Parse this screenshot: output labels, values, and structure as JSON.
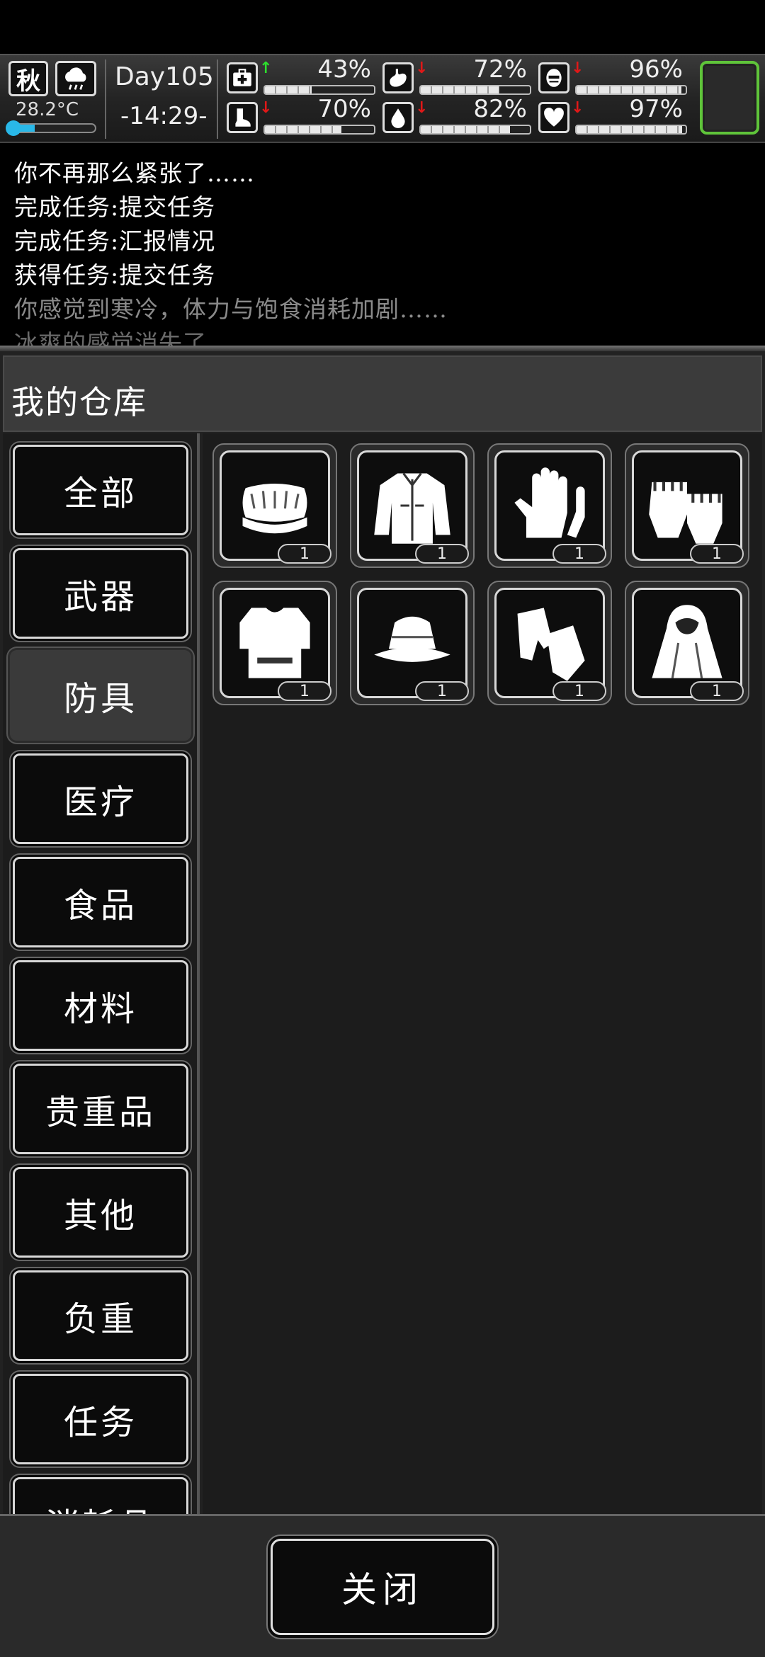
{
  "status": {
    "season": "秋",
    "weather_icon": "cloud-rain-icon",
    "temperature": "28.2°C",
    "temperature_level": 0.3,
    "day": "Day105",
    "time": "-14:29-",
    "stats": [
      {
        "icon": "medkit-icon",
        "trend": "up",
        "arrow": "↑",
        "value": "43%",
        "level": 0.43
      },
      {
        "icon": "stomach-icon",
        "trend": "down",
        "arrow": "↓",
        "value": "72%",
        "level": 0.72
      },
      {
        "icon": "face-mask-icon",
        "trend": "down",
        "arrow": "↓",
        "value": "96%",
        "level": 0.96
      },
      {
        "icon": "boot-icon",
        "trend": "down",
        "arrow": "↓",
        "value": "70%",
        "level": 0.7
      },
      {
        "icon": "water-drop-icon",
        "trend": "down",
        "arrow": "↓",
        "value": "82%",
        "level": 0.82
      },
      {
        "icon": "heart-icon",
        "trend": "down",
        "arrow": "↓",
        "value": "97%",
        "level": 0.97
      }
    ],
    "accent_color": "#5fc43a"
  },
  "log": {
    "lines": [
      {
        "text": "你不再那么紧张了……",
        "color": "#ffffff"
      },
      {
        "text": "完成任务:提交任务",
        "color": "#ffffff"
      },
      {
        "text": "完成任务:汇报情况",
        "color": "#ffffff"
      },
      {
        "text": "获得任务:提交任务",
        "color": "#ffffff"
      },
      {
        "text": "你感觉到寒冷，体力与饱食消耗加剧……",
        "color": "#8a8a8a"
      },
      {
        "text": "冰爽的感觉消失了……",
        "color": "#6a6a6a"
      }
    ]
  },
  "panel": {
    "title": "我的仓库",
    "categories": [
      {
        "label": "全部",
        "active": false
      },
      {
        "label": "武器",
        "active": false
      },
      {
        "label": "防具",
        "active": true
      },
      {
        "label": "医疗",
        "active": false
      },
      {
        "label": "食品",
        "active": false
      },
      {
        "label": "材料",
        "active": false
      },
      {
        "label": "贵重品",
        "active": false
      },
      {
        "label": "其他",
        "active": false
      },
      {
        "label": "负重",
        "active": false
      },
      {
        "label": "任务",
        "active": false
      },
      {
        "label": "消耗品",
        "active": false
      }
    ],
    "items": [
      {
        "icon": "fur-hat-icon",
        "count": "1"
      },
      {
        "icon": "jacket-icon",
        "count": "1"
      },
      {
        "icon": "gloves-icon",
        "count": "1"
      },
      {
        "icon": "fingerless-gloves-icon",
        "count": "1"
      },
      {
        "icon": "body-armor-icon",
        "count": "1"
      },
      {
        "icon": "bucket-hat-icon",
        "count": "1"
      },
      {
        "icon": "mittens-icon",
        "count": "1"
      },
      {
        "icon": "cloak-icon",
        "count": "1"
      }
    ],
    "close_label": "关闭"
  }
}
